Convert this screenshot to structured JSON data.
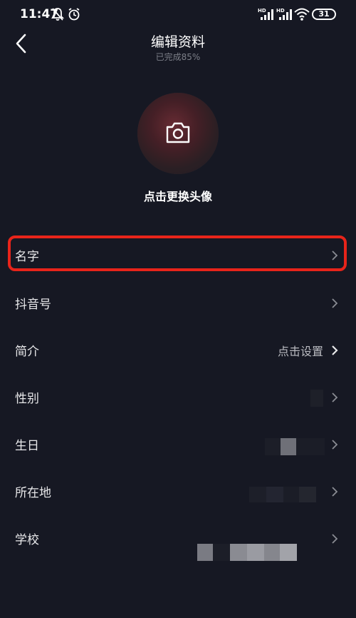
{
  "status_bar": {
    "time": "11:47",
    "network_label": "HD",
    "battery_level": "31",
    "icons": [
      "mute-bell-icon",
      "alarm-icon",
      "signal-icon",
      "signal-icon",
      "wifi-icon",
      "battery-icon"
    ]
  },
  "header": {
    "title": "编辑资料",
    "subtitle": "已完成85%",
    "back_icon": "chevron-left-icon"
  },
  "avatar": {
    "caption": "点击更换头像",
    "icon": "camera-icon"
  },
  "rows": [
    {
      "label": "名字",
      "value": ""
    },
    {
      "label": "抖音号",
      "value": ""
    },
    {
      "label": "简介",
      "value": "点击设置"
    },
    {
      "label": "性别",
      "value": ""
    },
    {
      "label": "生日",
      "value": ""
    },
    {
      "label": "所在地",
      "value": ""
    },
    {
      "label": "学校",
      "value": ""
    }
  ],
  "colors": {
    "background": "#161823",
    "highlight": "#e8241a",
    "muted_text": "#7c7f88"
  }
}
